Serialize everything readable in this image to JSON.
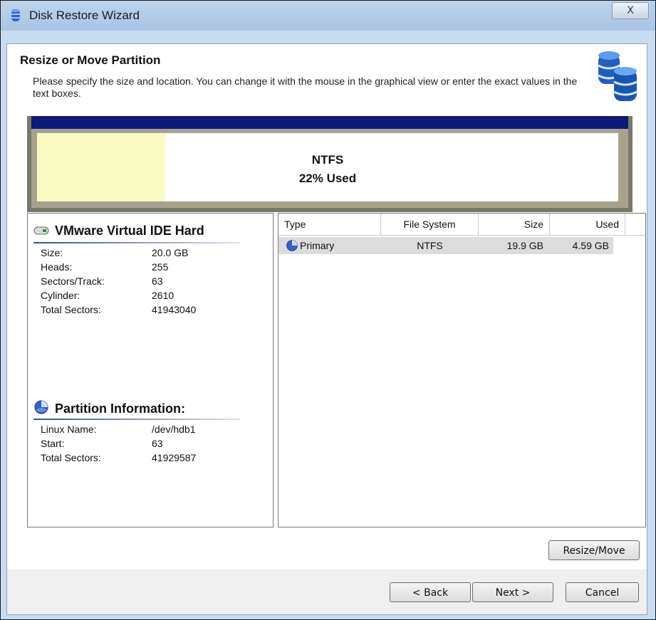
{
  "window": {
    "title": "Disk Restore Wizard",
    "close_glyph": "X"
  },
  "header": {
    "title": "Resize or Move Partition",
    "description": "Please specify the size and location. You can change it with the mouse in the graphical view or enter the exact values in the text boxes."
  },
  "disk_map": {
    "filesystem": "NTFS",
    "used_label": "22% Used",
    "used_fraction": 0.22,
    "colors": {
      "bar": "#0b1b7b",
      "used": "#fafac3",
      "frame": "#a6a28c"
    }
  },
  "disk_info": {
    "title": "VMware Virtual IDE Hard",
    "fields": [
      {
        "label": "Size:",
        "value": "20.0 GB"
      },
      {
        "label": "Heads:",
        "value": "255"
      },
      {
        "label": "Sectors/Track:",
        "value": "63"
      },
      {
        "label": "Cylinder:",
        "value": "2610"
      },
      {
        "label": "Total Sectors:",
        "value": "41943040"
      }
    ]
  },
  "partition_info": {
    "title": "Partition Information:",
    "fields": [
      {
        "label": "Linux Name:",
        "value": "/dev/hdb1"
      },
      {
        "label": "Start:",
        "value": "63"
      },
      {
        "label": "Total Sectors:",
        "value": "41929587"
      }
    ]
  },
  "table": {
    "columns": [
      "Type",
      "File System",
      "Size",
      "Used"
    ],
    "rows": [
      {
        "type": "Primary",
        "filesystem": "NTFS",
        "size": "19.9 GB",
        "used": "4.59 GB"
      }
    ]
  },
  "buttons": {
    "resize_move": "Resize/Move",
    "back": "< Back",
    "next": "Next >",
    "cancel": "Cancel"
  },
  "icons": {
    "app": "database-icon",
    "header": "databases-icon",
    "disk": "hard-disk-icon",
    "partition": "partition-icon"
  }
}
